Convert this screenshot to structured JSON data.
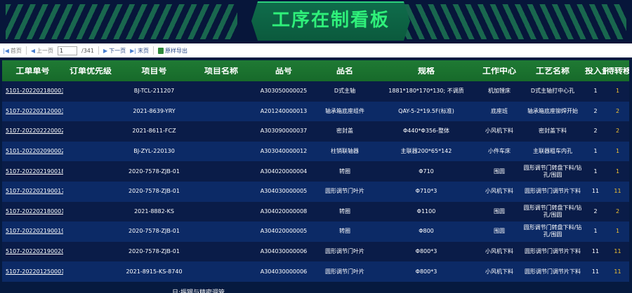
{
  "header": {
    "title": "工序在制看板"
  },
  "toolbar": {
    "first": "首页",
    "prev": "上一页",
    "page_value": "1",
    "total_pages": "/341",
    "next": "下一页",
    "last": "末页",
    "export": "原样导出"
  },
  "columns": [
    "工单单号",
    "订单优先级",
    "项目号",
    "项目名称",
    "品号",
    "品名",
    "规格",
    "工作中心",
    "工艺名称",
    "投入量",
    "待转移量"
  ],
  "rows": [
    [
      "5101-202202180003",
      "",
      "BJ-TCL-211207",
      "",
      "A303050000025",
      "D式主轴",
      "1881*180*170*130; 不调质",
      "机加镗床",
      "D式主轴打中心孔",
      "1",
      "1"
    ],
    [
      "5107-202202120003",
      "",
      "2021-8639-YRY",
      "",
      "A201240000013",
      "轴承箱底座组件",
      "QAY-5-2*19.5F(标准)",
      "底座班",
      "轴承箱底座铆焊开始",
      "2",
      "2"
    ],
    [
      "5107-202202220002",
      "",
      "2021-8611-FCZ",
      "",
      "A303090000037",
      "密封盖",
      "Φ440*Φ356-整体",
      "小风机下料",
      "密封盖下料",
      "2",
      "2"
    ],
    [
      "5101-202202090002",
      "",
      "BJ-ZYL-220130",
      "",
      "A303040000012",
      "柱销联轴器",
      "主联器200*65*142",
      "小件车床",
      "主联器粗车内孔",
      "1",
      "1"
    ],
    [
      "5107-202202190018",
      "",
      "2020-7578-ZJB-01",
      "",
      "A304020000004",
      "转圈",
      "Φ710",
      "围圆",
      "圆形调节门转盘下料/钻孔/围圆",
      "1",
      "1"
    ],
    [
      "5107-202202190017",
      "",
      "2020-7578-ZJB-01",
      "",
      "A304030000005",
      "圆形调节门叶片",
      "Φ710*3",
      "小风机下料",
      "圆形调节门调节片下料",
      "11",
      "11"
    ],
    [
      "5107-202202180001",
      "",
      "2021-8882-KS",
      "",
      "A304020000008",
      "转圈",
      "Φ1100",
      "围圆",
      "圆形调节门转盘下料/钻孔/围圆",
      "2",
      "2"
    ],
    [
      "5107-202202190019",
      "",
      "2020-7578-ZJB-01",
      "",
      "A304020000005",
      "转圈",
      "Φ800",
      "围圆",
      "圆形调节门转盘下料/钻孔/围圆",
      "1",
      "1"
    ],
    [
      "5107-202202190020",
      "",
      "2020-7578-ZJB-01",
      "",
      "A304030000006",
      "圆形调节门叶片",
      "Φ800*3",
      "小风机下料",
      "圆形调节门调节片下料",
      "11",
      "11"
    ],
    [
      "5107-202201250001",
      "",
      "2021-8915-KS-8740",
      "",
      "A304030000006",
      "圆形调节门叶片",
      "Φ800*3",
      "小风机下料",
      "圆形调节门调节片下料",
      "11",
      "11"
    ]
  ],
  "overflow_text": "日:振钢与精密调管",
  "colors": {
    "background": "#061a3f",
    "header_green": "#1f7a34",
    "title_green": "#2ff07a",
    "row_dark": "#0a1c48",
    "row_light": "#0c2a66",
    "highlight_yellow": "#f5c431"
  }
}
